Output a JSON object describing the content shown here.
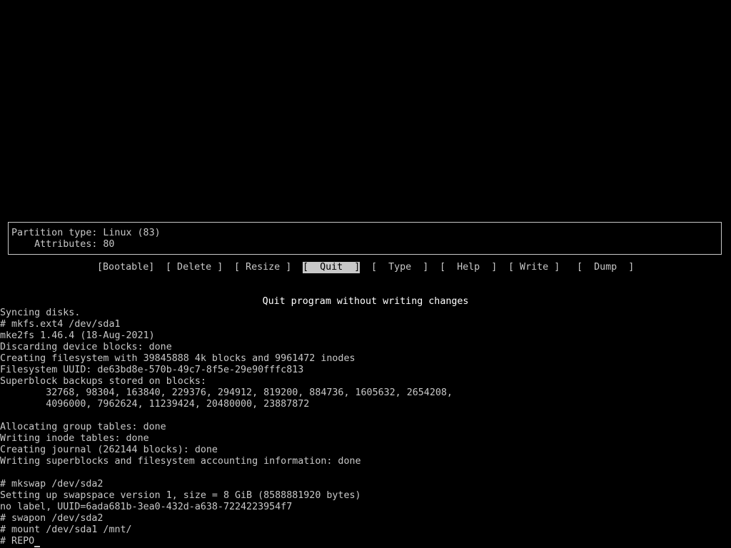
{
  "partition_info": {
    "type_line": "Partition type: Linux (83)",
    "attributes_line": "    Attributes: 80"
  },
  "menu": {
    "items": [
      {
        "label": "[Bootable]"
      },
      {
        "label": "[ Delete ]"
      },
      {
        "label": "[ Resize ]"
      },
      {
        "label": "[  Quit  ]",
        "selected": true
      },
      {
        "label": "[  Type  ]"
      },
      {
        "label": "[  Help  ]"
      },
      {
        "label": "[ Write ]"
      },
      {
        "label": "[  Dump  ]"
      }
    ]
  },
  "help_text": "Quit program without writing changes",
  "console": {
    "lines": [
      "Syncing disks.",
      "# mkfs.ext4 /dev/sda1",
      "mke2fs 1.46.4 (18-Aug-2021)",
      "Discarding device blocks: done",
      "Creating filesystem with 39845888 4k blocks and 9961472 inodes",
      "Filesystem UUID: de63bd8e-570b-49c7-8f5e-29e90fffc813",
      "Superblock backups stored on blocks:",
      "        32768, 98304, 163840, 229376, 294912, 819200, 884736, 1605632, 2654208,",
      "        4096000, 7962624, 11239424, 20480000, 23887872",
      "",
      "Allocating group tables: done",
      "Writing inode tables: done",
      "Creating journal (262144 blocks): done",
      "Writing superblocks and filesystem accounting information: done",
      "",
      "# mkswap /dev/sda2",
      "Setting up swapspace version 1, size = 8 GiB (8588881920 bytes)",
      "no label, UUID=6ada681b-3ea0-432d-a638-7224223954f7",
      "# swapon /dev/sda2",
      "# mount /dev/sda1 /mnt/"
    ],
    "prompt_line": "# REPO"
  }
}
